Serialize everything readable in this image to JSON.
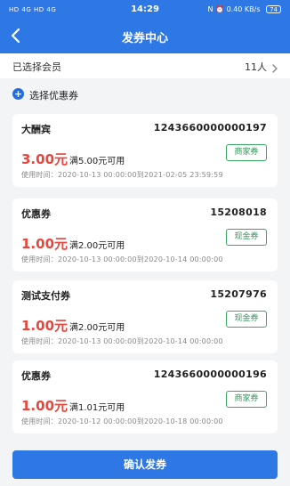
{
  "status_bar": {
    "left": "HD 4G HD 4G",
    "time": "14:29",
    "right": "N ⏰ 0.40 KB/s",
    "battery": "74"
  },
  "nav": {
    "title": "发券中心"
  },
  "member": {
    "label": "已选择会员",
    "count": "11人"
  },
  "select_coupon": {
    "icon": "plus-circle-icon",
    "label": "选择优惠券"
  },
  "coupons": [
    {
      "name": "大酬宾",
      "code": "1243660000000197",
      "amount": "3.00元",
      "condition": "满5.00元可用",
      "tag": "商家券",
      "time": "使用时间：2020-10-13  00:00:00到2021-02-05  23:59:59"
    },
    {
      "name": "优惠券",
      "code": "15208018",
      "amount": "1.00元",
      "condition": "满2.00元可用",
      "tag": "现金券",
      "time": "使用时间：2020-10-13  00:00:00到2020-10-14  00:00:00"
    },
    {
      "name": "测试支付券",
      "code": "15207976",
      "amount": "1.00元",
      "condition": "满2.00元可用",
      "tag": "现金券",
      "time": "使用时间：2020-10-13  00:00:00到2020-10-14  00:00:00"
    },
    {
      "name": "优惠券",
      "code": "1243660000000196",
      "amount": "1.00元",
      "condition": "满1.01元可用",
      "tag": "商家券",
      "time": "使用时间：2020-10-12  00:00:00到2020-10-18  00:00:00"
    }
  ],
  "confirm_button": "确认发券",
  "colors": {
    "brand": "#2e78e6",
    "amount": "#e8453c",
    "tag": "#2e9a57"
  }
}
